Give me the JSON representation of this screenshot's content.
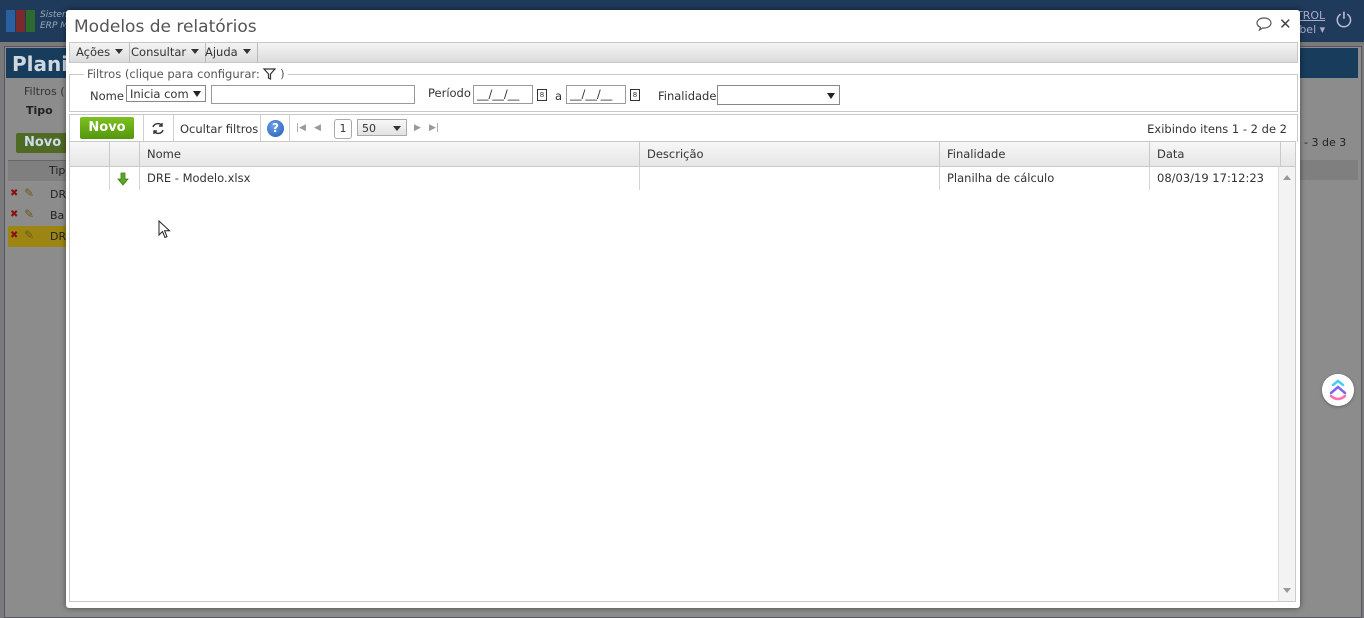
{
  "background": {
    "app_label": "Sistema",
    "app_sublabel": "ERP M",
    "user_name": "TROL",
    "user_sub": "bel",
    "page_title": "Plani",
    "filters_label": "Filtros (",
    "tipo_label": "Tipo",
    "novo_label": "Novo",
    "grid_header": "Tip",
    "rows": [
      {
        "label": "DR"
      },
      {
        "label": "Ba"
      },
      {
        "label": "DR"
      }
    ],
    "count_text": "- 3 de 3"
  },
  "modal": {
    "title": "Modelos de relatórios",
    "menu": [
      {
        "label": "Ações"
      },
      {
        "label": "Consultar"
      },
      {
        "label": "Ajuda"
      }
    ],
    "filters": {
      "legend": "Filtros (clique para configurar:",
      "legend_close": ")",
      "nome_label": "Nome",
      "nome_operator": "Inicia com",
      "nome_value": "",
      "periodo_label": "Período",
      "periodo_from": "__/__/__",
      "periodo_sep": "a",
      "periodo_to": "__/__/__",
      "finalidade_label": "Finalidade",
      "finalidade_value": ""
    },
    "toolbar": {
      "novo_label": "Novo",
      "ocultar_label": "Ocultar filtros",
      "help_label": "?",
      "page": "1",
      "page_size": "50",
      "exibindo": "Exibindo itens 1 - 2 de 2"
    },
    "grid": {
      "columns": [
        "Nome",
        "Descrição",
        "Finalidade",
        "Data"
      ],
      "rows": [
        {
          "nome": "DRE - Modelo.xlsx",
          "descricao": "",
          "finalidade": "Planilha de cálculo",
          "data": "08/03/19 17:12:23"
        }
      ]
    }
  },
  "colors": {
    "accent_green": "#6fb31a",
    "help_blue": "#1f5bb5",
    "bg_header": "#1f3a5a"
  }
}
